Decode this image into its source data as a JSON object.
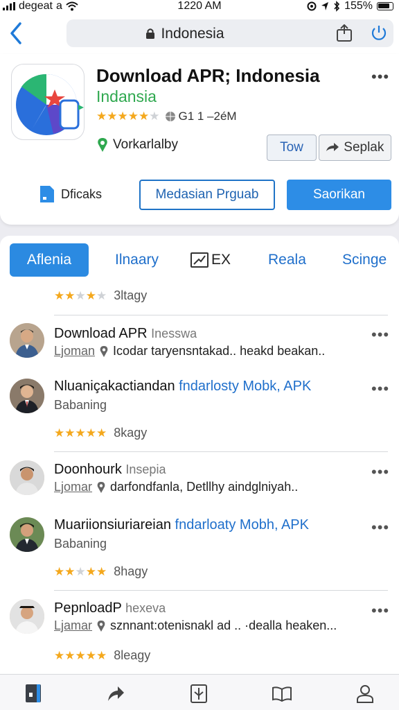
{
  "status": {
    "carrier": "degeat",
    "carrier_suffix": "a",
    "time": "1220 AM",
    "battery": "155%"
  },
  "browser": {
    "url": "Indonesia"
  },
  "app": {
    "title": "Download APR; Indonesia",
    "subtitle": "Indansia",
    "rating_text": "G1 1 –2éM",
    "location": "Vorkarlalby",
    "btn_tow": "Tow",
    "btn_seplak": "Seplak",
    "dficaks": "Dficaks",
    "btn_outline": "Medasian Prguab",
    "btn_primary": "Saorikan"
  },
  "tabs": [
    {
      "label": "Aflenia"
    },
    {
      "label": "Ilnaary"
    },
    {
      "label": "EX"
    },
    {
      "label": "Reala"
    },
    {
      "label": "Scinge"
    }
  ],
  "top_rating": {
    "text": "3ltagy"
  },
  "reviews": [
    {
      "title": "Download APR",
      "title_extra": "Inesswa",
      "user": "Ljoman",
      "body": "Icodar taryensntakad.. heakd beakan.."
    },
    {
      "title": "Nluaniçakactiandan",
      "title_extra": "fndarlosty Mobk, APK",
      "sub2": "Babaning",
      "rating_text": "8kagy"
    },
    {
      "title": "Doonhourk",
      "title_extra": "Insepia",
      "user": "Ljomar",
      "body": "darfondfanla,  Detllhy aindglniyah.."
    },
    {
      "title": "Muariionsiuriareian",
      "title_extra": "fndarloaty Mobh, APK",
      "sub2": "Babaning",
      "rating_text": "8hagy"
    },
    {
      "title": "PepnloadP",
      "title_extra": "hexeva",
      "user": "Ljamar",
      "body": "sznnant:otenisnakl ad .. ·dealla heaken...",
      "rating_text": "8leagy"
    }
  ],
  "bottom_nav": [
    "book-icon",
    "share-arrow-icon",
    "compass-icon",
    "open-book-icon",
    "person-icon"
  ],
  "colors": {
    "accent": "#2d8de6",
    "green": "#2fa84f",
    "star": "#f4a81d"
  }
}
